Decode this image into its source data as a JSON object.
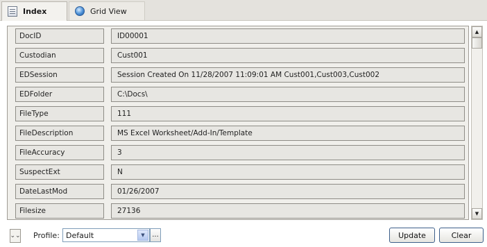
{
  "tabs": [
    {
      "label": "Index",
      "icon": "index-icon",
      "active": true
    },
    {
      "label": "Grid View",
      "icon": "grid-view-icon",
      "active": false
    }
  ],
  "fields": [
    {
      "name": "DocID",
      "value": "ID00001"
    },
    {
      "name": "Custodian",
      "value": "Cust001"
    },
    {
      "name": "EDSession",
      "value": "Session Created On 11/28/2007 11:09:01 AM Cust001,Cust003,Cust002"
    },
    {
      "name": "EDFolder",
      "value": "C:\\Docs\\"
    },
    {
      "name": "FileType",
      "value": "111"
    },
    {
      "name": "FileDescription",
      "value": "MS Excel Worksheet/Add-In/Template"
    },
    {
      "name": "FileAccuracy",
      "value": "3"
    },
    {
      "name": "SuspectExt",
      "value": "N"
    },
    {
      "name": "DateLastMod",
      "value": "01/26/2007"
    },
    {
      "name": "Filesize",
      "value": "27136"
    }
  ],
  "footer": {
    "expand_glyph": "⌄⌄",
    "profile_label": "Profile:",
    "profile_value": "Default",
    "browse_label": "...",
    "update_label": "Update",
    "clear_label": "Clear"
  }
}
